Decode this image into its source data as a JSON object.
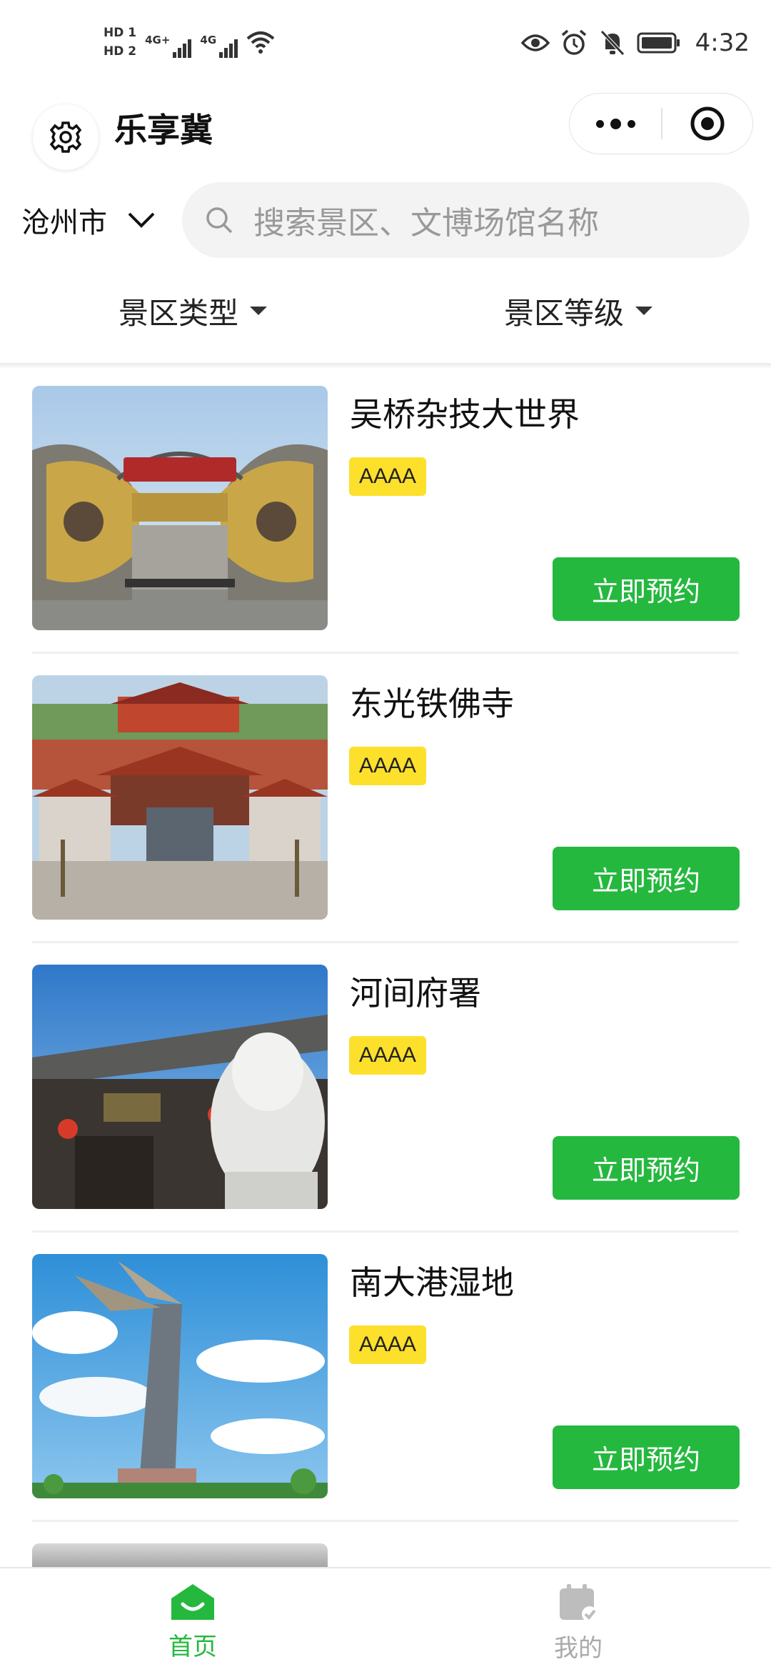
{
  "status_bar": {
    "hd1": "HD 1",
    "hd2": "HD 2",
    "net1": "4G+",
    "net2": "4G",
    "time": "4:32"
  },
  "header": {
    "title": "乐享冀"
  },
  "search": {
    "city": "沧州市",
    "placeholder": "搜索景区、文博场馆名称"
  },
  "filters": {
    "type_label": "景区类型",
    "level_label": "景区等级"
  },
  "items": [
    {
      "name": "吴桥杂技大世界",
      "level": "AAAA",
      "button": "立即预约"
    },
    {
      "name": "东光铁佛寺",
      "level": "AAAA",
      "button": "立即预约"
    },
    {
      "name": "河间府署",
      "level": "AAAA",
      "button": "立即预约"
    },
    {
      "name": "南大港湿地",
      "level": "AAAA",
      "button": "立即预约"
    }
  ],
  "tabbar": {
    "home": "首页",
    "mine": "我的"
  },
  "colors": {
    "accent": "#25b83f",
    "badge": "#fde02b"
  }
}
